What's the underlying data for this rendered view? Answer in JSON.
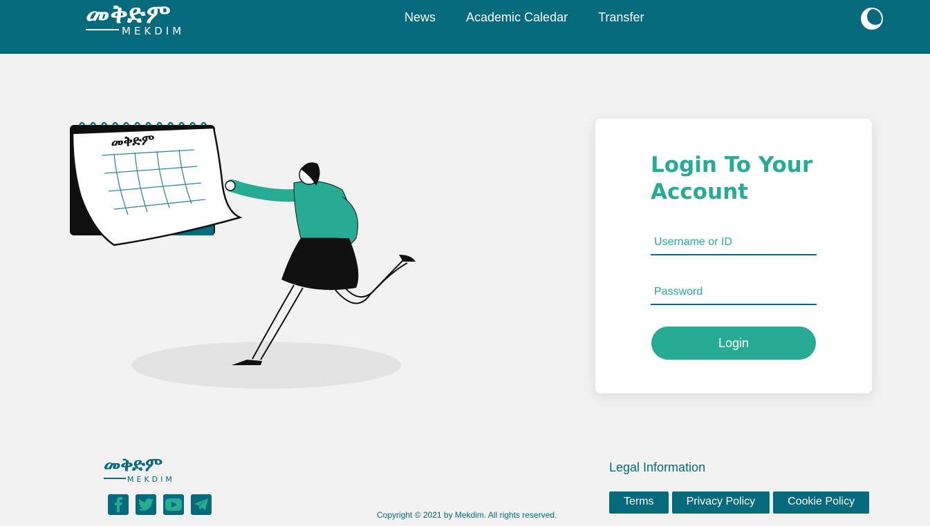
{
  "brand": {
    "logo_geez": "መቅድም",
    "logo_latin": "MEKDIM",
    "primary_color": "#046a7c",
    "accent_color": "#27ac94"
  },
  "header": {
    "nav": [
      {
        "label": "News"
      },
      {
        "label": "Academic Caledar"
      },
      {
        "label": "Transfer"
      }
    ],
    "theme_toggle_icon": "moon-icon"
  },
  "illustration": {
    "calendar_text": "መቅድም",
    "description_icon": "woman-running-with-calendar"
  },
  "login": {
    "title": "Login To Your Account",
    "username_placeholder": "Username or ID",
    "password_placeholder": "Password",
    "button_label": "Login"
  },
  "footer": {
    "logo_geez": "መቅድም",
    "logo_latin": "MEKDIM",
    "socials": [
      "facebook-icon",
      "twitter-icon",
      "youtube-icon",
      "telegram-icon"
    ],
    "copyright": "Copyright © 2021 by Mekdim. All rights reserved.",
    "legal_title": "Legal Information",
    "legal_links": [
      {
        "label": "Terms"
      },
      {
        "label": "Privacy Policy"
      },
      {
        "label": "Cookie Policy"
      }
    ]
  }
}
